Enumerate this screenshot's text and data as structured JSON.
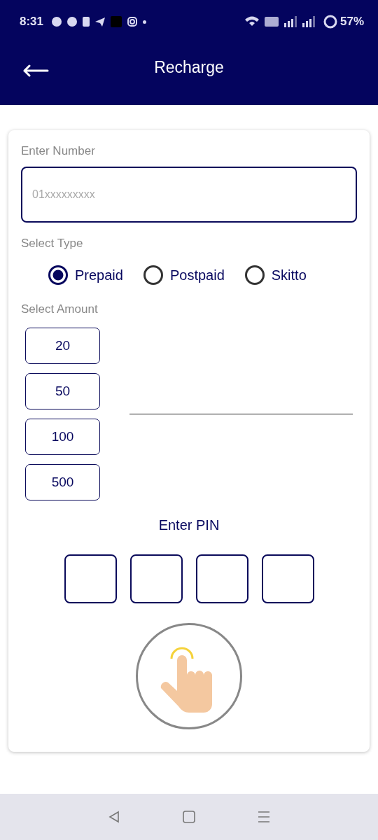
{
  "status_bar": {
    "time": "8:31",
    "battery": "57%"
  },
  "header": {
    "title": "Recharge"
  },
  "form": {
    "number_label": "Enter Number",
    "number_placeholder": "01xxxxxxxxx",
    "type_label": "Select Type",
    "types": [
      {
        "label": "Prepaid",
        "selected": true
      },
      {
        "label": "Postpaid",
        "selected": false
      },
      {
        "label": "Skitto",
        "selected": false
      }
    ],
    "amount_label": "Select Amount",
    "amounts": [
      "20",
      "50",
      "100",
      "500"
    ],
    "pin_label": "Enter PIN"
  }
}
